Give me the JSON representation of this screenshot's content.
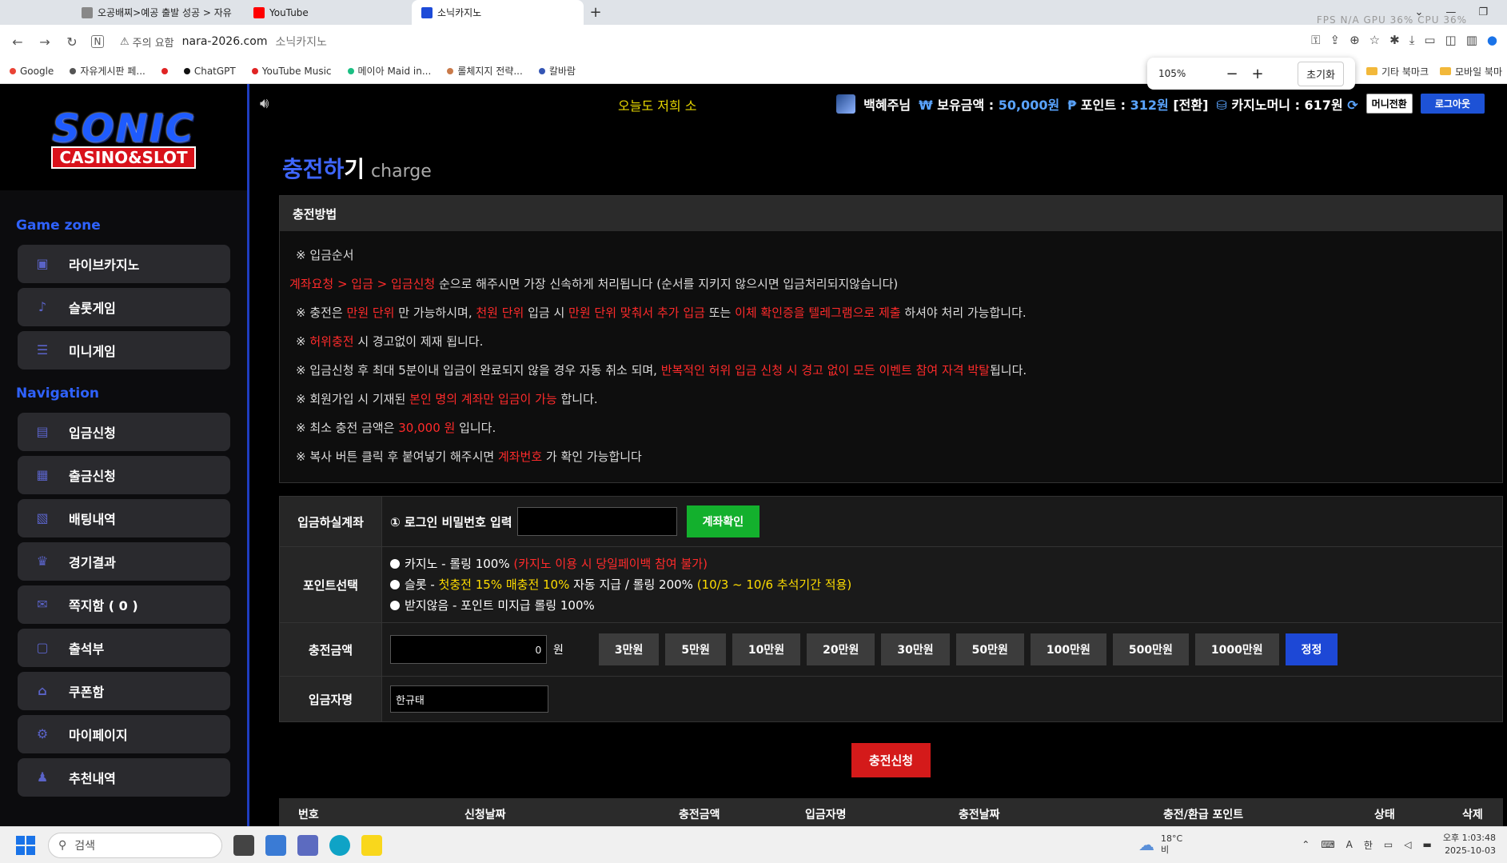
{
  "browser": {
    "tabs": [
      {
        "label": "오공배찌>예공 출발 성공 > 자유",
        "icon": "page-icon"
      },
      {
        "label": "YouTube",
        "icon": "youtube-icon"
      },
      {
        "label": "소닉카지노",
        "icon": "site-icon",
        "active": true
      }
    ],
    "new_tab": "+",
    "stats": "FPS N/A  GPU 36%  CPU 36%",
    "warn_label": "주의 요함",
    "url": "nara-2026.com",
    "url_title": "소닉카지노",
    "bookmarks": [
      "Google",
      "자유게시판 페...",
      "ChatGPT",
      "YouTube Music",
      "메이아 Maid in...",
      "롤체지지 전략...",
      "칼바람"
    ],
    "bookmark_colors": [
      "#ea4335",
      "#555555",
      "#e02424",
      "#111111",
      "#e02424",
      "#1bbf83",
      "#c97a4a",
      "#3455b4"
    ],
    "bookmarks_right": [
      "기타 북마크",
      "모바일 북마"
    ],
    "zoom": {
      "level": "105%",
      "minus": "−",
      "plus": "+",
      "reset": "초기화"
    }
  },
  "sidebar": {
    "logo_top": "SONIC",
    "logo_bottom": "CASINO&SLOT",
    "game_zone_title": "Game zone",
    "game_items": [
      "라이브카지노",
      "슬롯게임",
      "미니게임"
    ],
    "navigation_title": "Navigation",
    "nav_items": [
      "입금신청",
      "출금신청",
      "배팅내역",
      "경기결과",
      "쪽지함 ( 0 )",
      "출석부",
      "쿠폰함",
      "마이페이지",
      "추천내역"
    ]
  },
  "topbar": {
    "marquee": "오늘도 저희 소",
    "username": "백혜주님",
    "balance_label": "보유금액 :",
    "balance_value": "50,000원",
    "point_label": "포인트 :",
    "point_value": "312원",
    "point_convert": "[전환]",
    "casino_label": "카지노머니 : 617원",
    "money_convert": "머니전환",
    "logout": "로그아웃"
  },
  "page": {
    "title_kr_a": "충전하",
    "title_kr_b": "기",
    "title_en": "charge",
    "method_title": "충전방법",
    "notice": {
      "l1": "※ 입금순서",
      "l2_red": "계좌요청 > 입금 > 입금신청",
      "l2_rest": " 순으로 해주시면 가장 신속하게 처리됩니다 (순서를 지키지 않으시면 입금처리되지않습니다)",
      "l3_a": "※ 충전은 ",
      "l3_b": "만원 단위",
      "l3_c": " 만 가능하시며, ",
      "l3_d": "천원 단위",
      "l3_e": " 입금 시 ",
      "l3_f": "만원 단위 맞춰서 추가 입금",
      "l3_g": " 또는 ",
      "l3_h": "이체 확인증을 텔레그램으로 제출",
      "l3_i": " 하셔야 처리 가능합니다.",
      "l4_a": "※ ",
      "l4_b": "허위충전",
      "l4_c": " 시 경고없이 제재 됩니다.",
      "l5_a": "※ 입금신청 후 최대 5분이내 입금이 완료되지 않을 경우 자동 취소 되며, ",
      "l5_b": "반복적인 허위 입금 신청 시 경고 없이 모든 이벤트 참여 자격 박탈",
      "l5_c": "됩니다.",
      "l6_a": "※ 회원가입 시 기재된 ",
      "l6_b": "본인 명의 계좌만 입금이 가능",
      "l6_c": " 합니다.",
      "l7_a": "※ 최소 충전 금액은 ",
      "l7_b": "30,000 원",
      "l7_c": " 입니다.",
      "l8_a": "※ 복사 버튼 클릭 후 붙여넣기 해주시면 ",
      "l8_b": "계좌번호",
      "l8_c": " 가 확인 가능합니다"
    },
    "form": {
      "account_label": "입금하실계좌",
      "pw_label": "① 로그인 비밀번호 입력",
      "account_check": "계좌확인",
      "point_label": "포인트선택",
      "opt1_a": "카지노 - 롤링 100% ",
      "opt1_b": "(카지노 이용 시 당일페이백 참여 불가)",
      "opt2_a": "슬롯 - ",
      "opt2_b": "첫충전 15% 매충전 10%",
      "opt2_c": " 자동 지급 / 롤링 200% ",
      "opt2_d": "(10/3 ~ 10/6 추석기간 적용)",
      "opt3": "받지않음 - 포인트 미지급 롤링 100%",
      "amount_label": "충전금액",
      "amount_value": "0",
      "amount_unit": "원",
      "amount_buttons": [
        "3만원",
        "5만원",
        "10만원",
        "20만원",
        "30만원",
        "50만원",
        "100만원",
        "500만원",
        "1000만원"
      ],
      "amount_reset": "정정",
      "depositor_label": "입금자명",
      "depositor_value": "한규태"
    },
    "submit": "충전신청",
    "history_columns": [
      "번호",
      "신청날짜",
      "충전금액",
      "입금자명",
      "충전날짜",
      "충전/환급 포인트",
      "상태",
      "삭제"
    ]
  },
  "taskbar": {
    "search_placeholder": "검색",
    "weather_temp": "18°C",
    "weather_desc": "비",
    "ime_a": "A",
    "ime_b": "한",
    "time": "오후 1:03:48",
    "date": "2025-10-03"
  }
}
